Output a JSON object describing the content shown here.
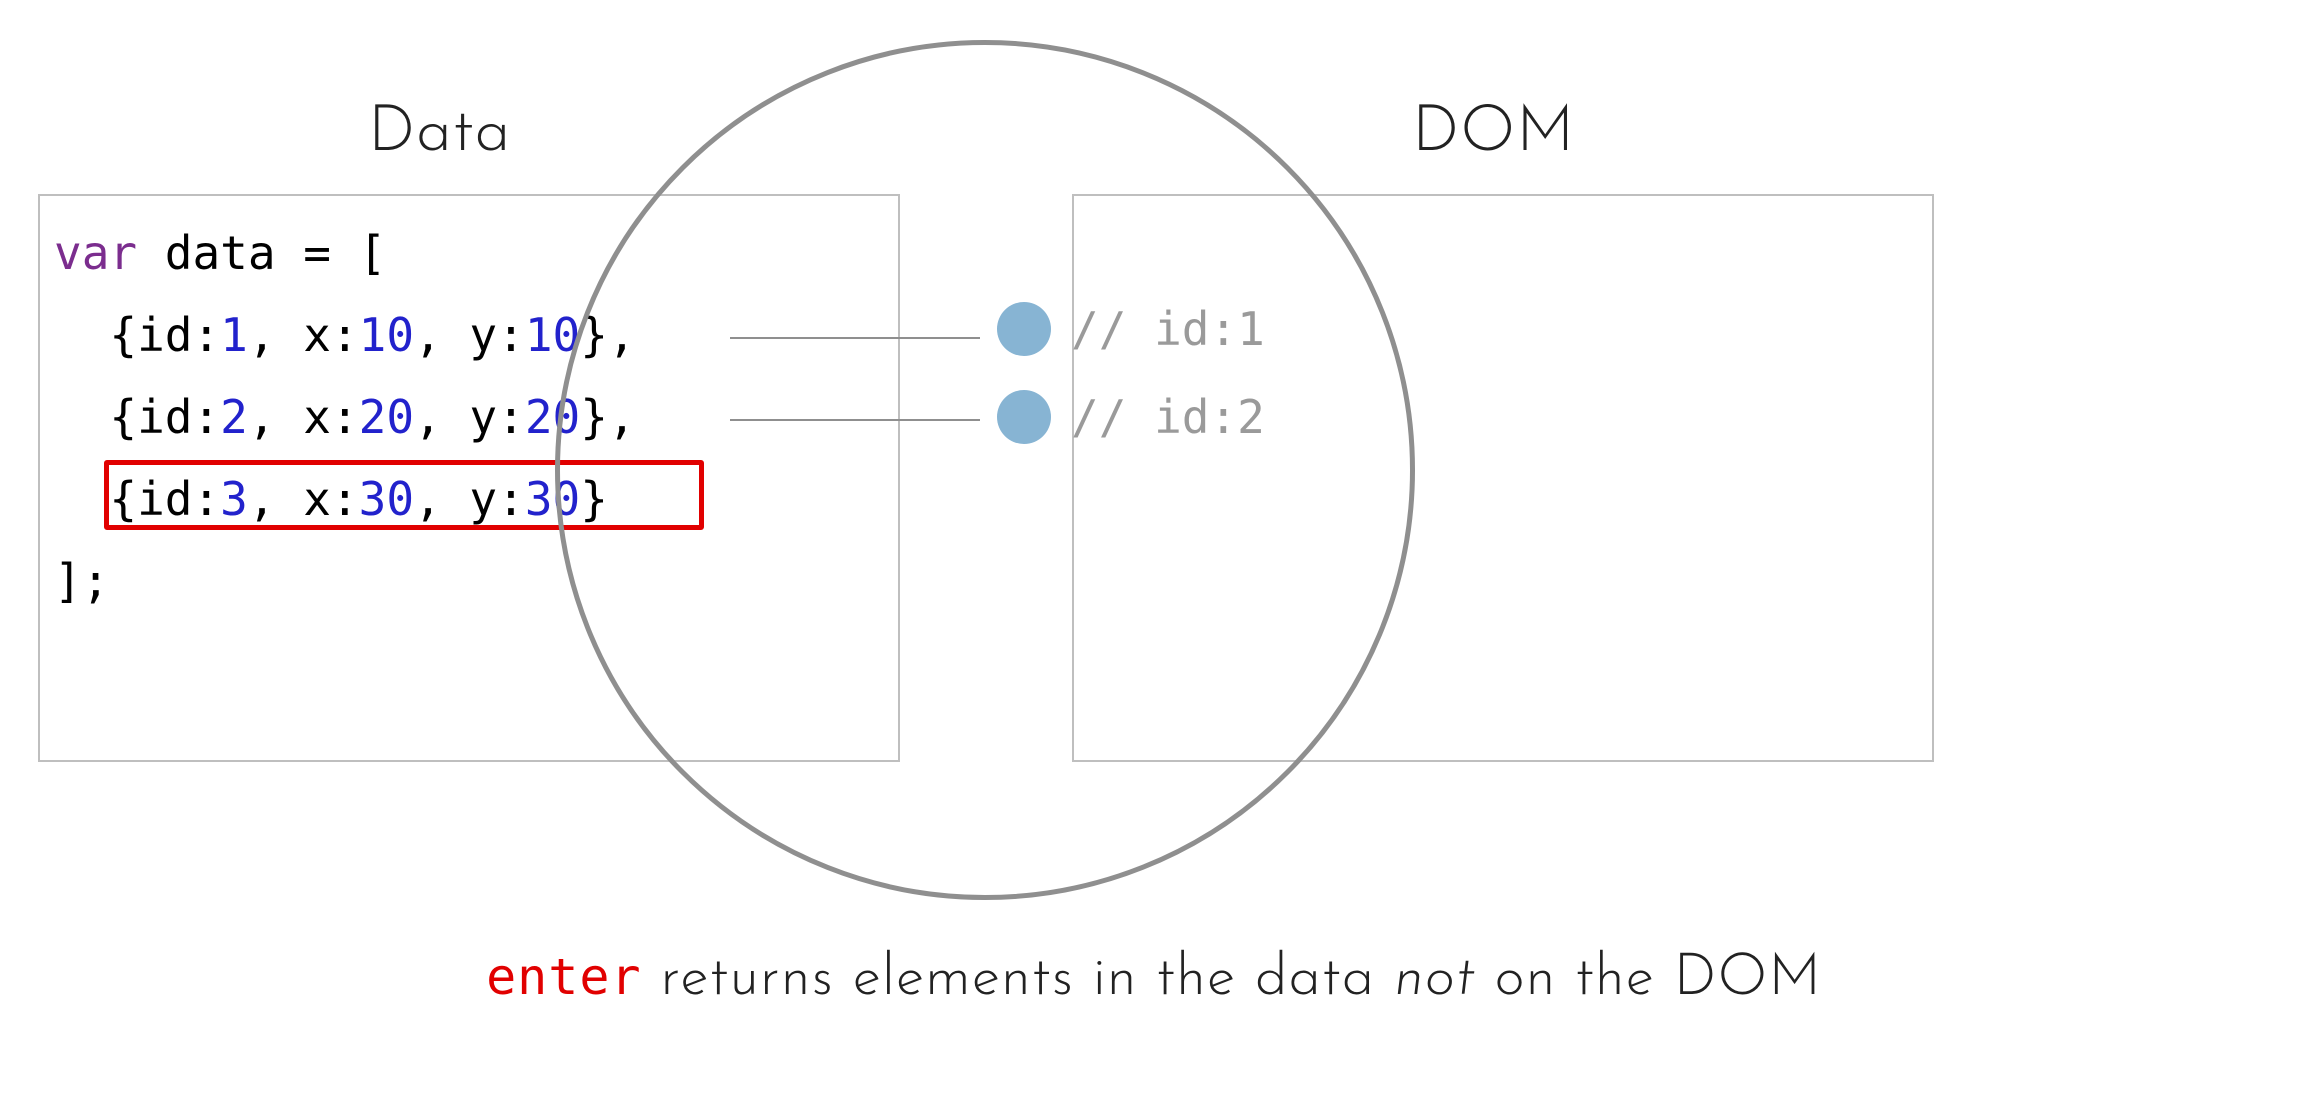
{
  "headings": {
    "data": "Data",
    "dom": "DOM"
  },
  "code": {
    "var_kw": "var",
    "decl": " data = [",
    "row1_a": "  {id:",
    "row1_b": "1",
    "row1_c": ", x:",
    "row1_d": "10",
    "row1_e": ", y:",
    "row1_f": "10",
    "row1_g": "},",
    "row2_a": "  {id:",
    "row2_b": "2",
    "row2_c": ", x:",
    "row2_d": "20",
    "row2_e": ", y:",
    "row2_f": "20",
    "row2_g": "},",
    "row3_a": "  {id:",
    "row3_b": "3",
    "row3_c": ", x:",
    "row3_d": "30",
    "row3_e": ", y:",
    "row3_f": "30",
    "row3_g": "}",
    "close": "];"
  },
  "dom_comments": {
    "c1": "// id:1",
    "c2": "// id:2"
  },
  "caption": {
    "enter": "enter",
    "part1": " returns elements in the data ",
    "not": "not",
    "part2": " on the DOM"
  },
  "chart_data": {
    "type": "diagram",
    "title": "D3 enter selection: data not yet in the DOM",
    "data_array": [
      {
        "id": 1,
        "x": 10,
        "y": 10,
        "in_dom": true
      },
      {
        "id": 2,
        "x": 20,
        "y": 20,
        "in_dom": true
      },
      {
        "id": 3,
        "x": 30,
        "y": 30,
        "in_dom": false,
        "highlighted": true
      }
    ],
    "dom_elements": [
      {
        "id": 1
      },
      {
        "id": 2
      }
    ],
    "enter_selection": [
      {
        "id": 3
      }
    ],
    "annotations": [
      "enter returns elements in the data not on the DOM"
    ]
  }
}
